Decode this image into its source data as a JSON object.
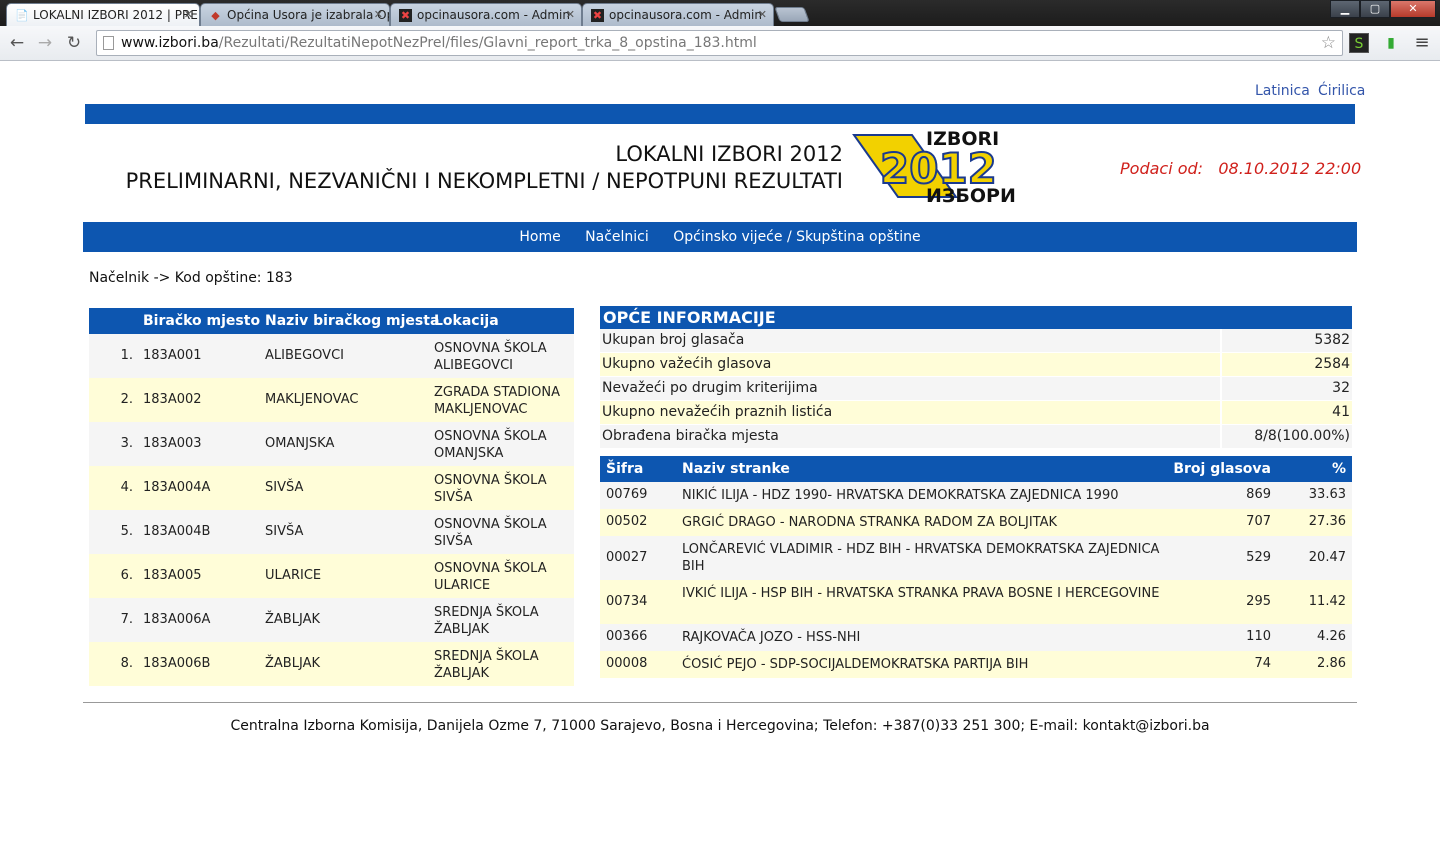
{
  "browser": {
    "tabs": [
      {
        "title": "LOKALNI IZBORI 2012 | PRE",
        "active": true
      },
      {
        "title": "Općina Usora je izabrala Op",
        "active": false
      },
      {
        "title": "opcinausora.com - Admin",
        "active": false
      },
      {
        "title": "opcinausora.com - Admin",
        "active": false
      }
    ],
    "url_host": "www.izbori.ba",
    "url_path": "/Rezultati/RezultatiNepotNezPrel/files/Glavni_report_trka_8_opstina_183.html"
  },
  "lang": {
    "latin": "Latinica",
    "cyrillic": "Ćirilica"
  },
  "header": {
    "title1": "LOKALNI IZBORI 2012",
    "title2": "PRELIMINARNI, NEZVANIČNI I NEKOMPLETNI / NEPOTPUNI REZULTATI",
    "logo_top": "IZBORI",
    "logo_year": "2012",
    "logo_bottom": "ИЗБОРИ",
    "podaci_label": "Podaci od:",
    "podaci_value": "08.10.2012 22:00"
  },
  "menu": {
    "home": "Home",
    "nacelnici": "Načelnici",
    "vijece": "Općinsko vijeće / Skupština opštine"
  },
  "breadcrumb": "Načelnik -> Kod opštine: 183",
  "polling": {
    "headers": {
      "code": "Biračko mjesto",
      "name": "Naziv biračkog mjesta",
      "location": "Lokacija"
    },
    "rows": [
      {
        "num": "1.",
        "code": "183A001",
        "name": "ALIBEGOVCI",
        "location": "OSNOVNA ŠKOLA ALIBEGOVCI"
      },
      {
        "num": "2.",
        "code": "183A002",
        "name": "MAKLJENOVAC",
        "location": "ZGRADA STADIONA MAKLJENOVAC"
      },
      {
        "num": "3.",
        "code": "183A003",
        "name": "OMANJSKA",
        "location": "OSNOVNA ŠKOLA OMANJSKA"
      },
      {
        "num": "4.",
        "code": "183A004A",
        "name": "SIVŠA",
        "location": "OSNOVNA ŠKOLA SIVŠA"
      },
      {
        "num": "5.",
        "code": "183A004B",
        "name": "SIVŠA",
        "location": "OSNOVNA ŠKOLA SIVŠA"
      },
      {
        "num": "6.",
        "code": "183A005",
        "name": "ULARICE",
        "location": "OSNOVNA ŠKOLA ULARICE"
      },
      {
        "num": "7.",
        "code": "183A006A",
        "name": "ŽABLJAK",
        "location": "SREDNJA ŠKOLA ŽABLJAK"
      },
      {
        "num": "8.",
        "code": "183A006B",
        "name": "ŽABLJAK",
        "location": "SREDNJA ŠKOLA ŽABLJAK"
      }
    ]
  },
  "info": {
    "title": "OPĆE INFORMACIJE",
    "rows": [
      {
        "label": "Ukupan broj glasača",
        "value": "5382"
      },
      {
        "label": "Ukupno važećih glasova",
        "value": "2584"
      },
      {
        "label": "Nevažeći po drugim kriterijima",
        "value": "32"
      },
      {
        "label": "Ukupno nevažećih praznih listića",
        "value": "41"
      },
      {
        "label": "Obrađena biračka mjesta",
        "value": "8/8(100.00%)"
      }
    ]
  },
  "parties": {
    "headers": {
      "code": "Šifra",
      "name": "Naziv stranke",
      "votes": "Broj glasova",
      "pct": "%"
    },
    "rows": [
      {
        "code": "00769",
        "name": "NIKIĆ ILIJA - HDZ 1990- HRVATSKA DEMOKRATSKA ZAJEDNICA 1990",
        "votes": "869",
        "pct": "33.63"
      },
      {
        "code": "00502",
        "name": "GRGIĆ DRAGO - NARODNA STRANKA RADOM ZA BOLJITAK",
        "votes": "707",
        "pct": "27.36"
      },
      {
        "code": "00027",
        "name": "LONČAREVIĆ VLADIMIR - HDZ BIH - HRVATSKA DEMOKRATSKA ZAJEDNICA BIH",
        "votes": "529",
        "pct": "20.47"
      },
      {
        "code": "00734",
        "name": "IVKIĆ ILIJA - HSP BIH - HRVATSKA STRANKA PRAVA BOSNE I HERCEGOVINE",
        "votes": "295",
        "pct": "11.42"
      },
      {
        "code": "00366",
        "name": "RAJKOVAČA JOZO - HSS-NHI",
        "votes": "110",
        "pct": "4.26"
      },
      {
        "code": "00008",
        "name": "ĆOSIĆ PEJO - SDP-SOCIJALDEMOKRATSKA PARTIJA BIH",
        "votes": "74",
        "pct": "2.86"
      }
    ]
  },
  "footer": "Centralna Izborna Komisija, Danijela Ozme 7, 71000 Sarajevo, Bosna i Hercegovina; Telefon: +387(0)33 251 300; E-mail: kontakt@izbori.ba"
}
